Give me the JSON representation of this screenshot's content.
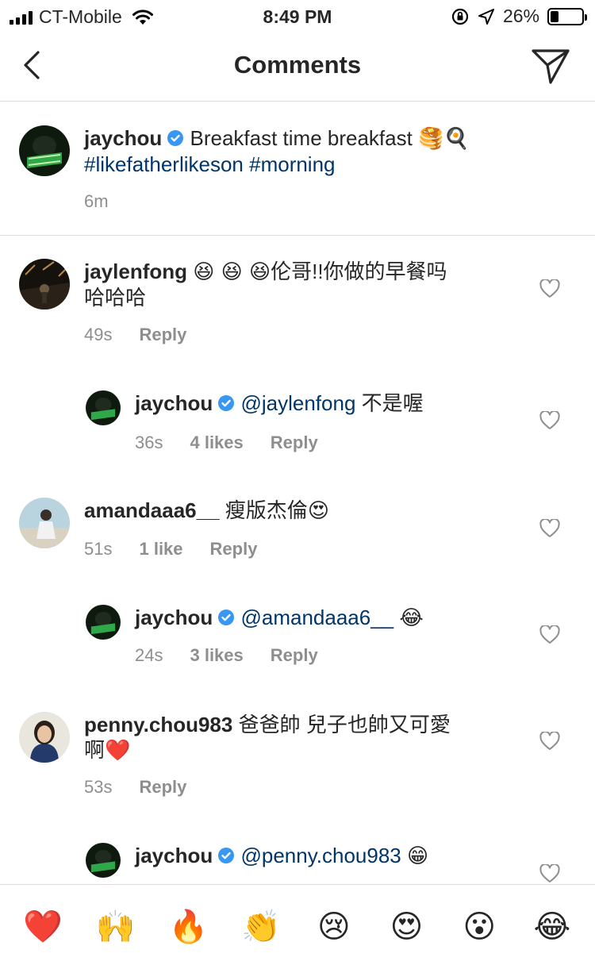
{
  "status_bar": {
    "carrier": "CT-Mobile",
    "time": "8:49 PM",
    "battery": "26%",
    "battery_level": 0.26
  },
  "nav": {
    "title": "Comments"
  },
  "caption": {
    "username": "jaychou",
    "text": "Breakfast time breakfast",
    "emoji": "🥞🍳",
    "hashtags": "#likefatherlikeson #morning",
    "time": "6m"
  },
  "comments": [
    {
      "username": "jaylenfong",
      "emoji_prefix": "😆 😆 😆",
      "text_line1": "伦哥!!你做的早餐吗",
      "text_line2": "哈哈哈",
      "time": "49s",
      "reply_label": "Reply"
    },
    {
      "username": "jaychou",
      "mention": "@jaylenfong",
      "text": "不是喔",
      "time": "36s",
      "likes": "4 likes",
      "reply_label": "Reply"
    },
    {
      "username": "amandaaa6__",
      "text": "瘦版杰倫",
      "emoji": "😍",
      "time": "51s",
      "likes": "1 like",
      "reply_label": "Reply"
    },
    {
      "username": "jaychou",
      "mention": "@amandaaa6__",
      "emoji": "😂",
      "time": "24s",
      "likes": "3 likes",
      "reply_label": "Reply"
    },
    {
      "username": "penny.chou983",
      "text_line1": "爸爸帥 兒子也帥又可愛",
      "text_line2": "啊",
      "emoji": "❤️",
      "time": "53s",
      "reply_label": "Reply"
    },
    {
      "username": "jaychou",
      "mention": "@penny.chou983",
      "emoji": "😁"
    }
  ],
  "reactions": [
    "❤️",
    "🙌",
    "🔥",
    "👏",
    "😢",
    "😍",
    "😮",
    "😂"
  ],
  "colors": {
    "link": "#003569",
    "meta": "#8e8e8e",
    "verified": "#3897f0",
    "divider": "#dbdbdb"
  }
}
